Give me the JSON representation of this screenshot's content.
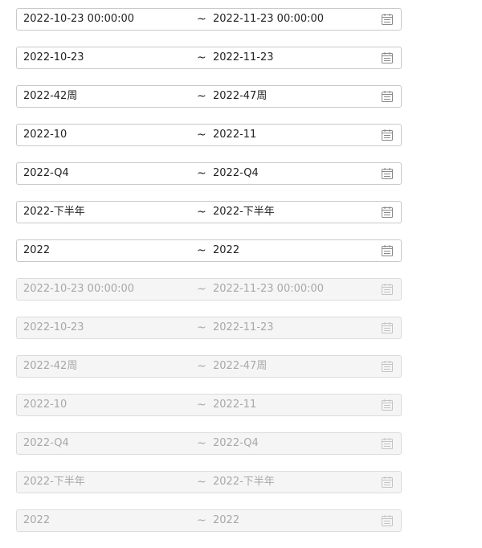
{
  "separator": "~",
  "pickers": [
    {
      "start": "2022-10-23 00:00:00",
      "end": "2022-11-23 00:00:00",
      "disabled": false
    },
    {
      "start": "2022-10-23",
      "end": "2022-11-23",
      "disabled": false
    },
    {
      "start": "2022-42周",
      "end": "2022-47周",
      "disabled": false
    },
    {
      "start": "2022-10",
      "end": "2022-11",
      "disabled": false
    },
    {
      "start": "2022-Q4",
      "end": "2022-Q4",
      "disabled": false
    },
    {
      "start": "2022-下半年",
      "end": "2022-下半年",
      "disabled": false
    },
    {
      "start": "2022",
      "end": "2022",
      "disabled": false
    },
    {
      "start": "2022-10-23 00:00:00",
      "end": "2022-11-23 00:00:00",
      "disabled": true
    },
    {
      "start": "2022-10-23",
      "end": "2022-11-23",
      "disabled": true
    },
    {
      "start": "2022-42周",
      "end": "2022-47周",
      "disabled": true
    },
    {
      "start": "2022-10",
      "end": "2022-11",
      "disabled": true
    },
    {
      "start": "2022-Q4",
      "end": "2022-Q4",
      "disabled": true
    },
    {
      "start": "2022-下半年",
      "end": "2022-下半年",
      "disabled": true
    },
    {
      "start": "2022",
      "end": "2022",
      "disabled": true
    }
  ],
  "icon": "calendar-icon"
}
